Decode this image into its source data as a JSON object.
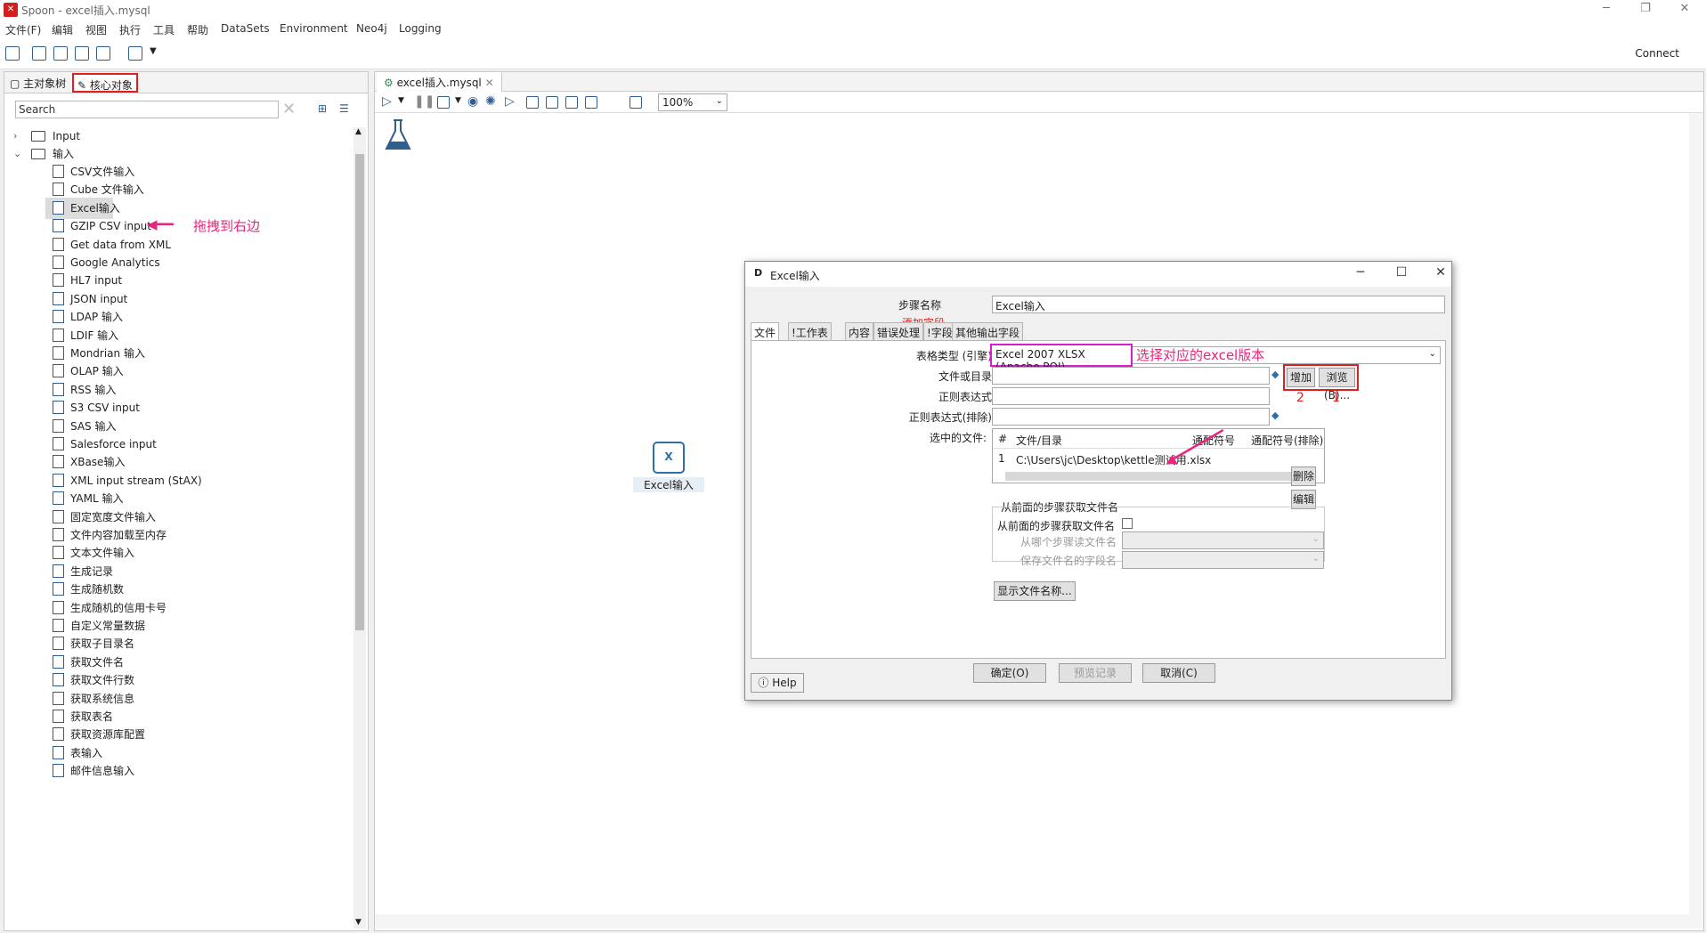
{
  "window": {
    "title": "Spoon - excel插入.mysql",
    "minimize_symbol": "─",
    "restore_symbol": "❐",
    "close_symbol": "✕"
  },
  "menubar": [
    "文件(F)",
    "编辑",
    "视图",
    "执行",
    "工具",
    "帮助",
    "DataSets",
    "Environment",
    "Neo4j",
    "Logging"
  ],
  "toolbar": {
    "connect_label": "Connect"
  },
  "left_panel": {
    "tabs": {
      "main_tree": "主对象树",
      "core_objects": "核心对象"
    },
    "search_placeholder": "Search",
    "tree": {
      "folders": [
        {
          "label": "Input",
          "expanded": false
        },
        {
          "label": "输入",
          "expanded": true
        }
      ],
      "steps": [
        "CSV文件输入",
        "Cube 文件输入",
        "Excel输入",
        "GZIP CSV input",
        "Get data from XML",
        "Google Analytics",
        "HL7 input",
        "JSON input",
        "LDAP 输入",
        "LDIF 输入",
        "Mondrian 输入",
        "OLAP 输入",
        "RSS 输入",
        "S3 CSV input",
        "SAS 输入",
        "Salesforce input",
        "XBase输入",
        "XML input stream (StAX)",
        "YAML 输入",
        "固定宽度文件输入",
        "文件内容加载至内存",
        "文本文件输入",
        "生成记录",
        "生成随机数",
        "生成随机的信用卡号",
        "自定义常量数据",
        "获取子目录名",
        "获取文件名",
        "获取文件行数",
        "获取系统信息",
        "获取表名",
        "获取资源库配置",
        "表输入",
        "邮件信息输入"
      ],
      "selected_index": 2
    }
  },
  "annotations": {
    "drag_hint": "拖拽到右边",
    "version_hint": "选择对应的excel版本",
    "num_1": "1",
    "num_2": "2"
  },
  "editor": {
    "tab_label": "excel插入.mysql",
    "zoom": "100%",
    "step_node_label": "Excel输入"
  },
  "dialog": {
    "title": "Excel输入",
    "step_name_label": "步骤名称",
    "step_name_value": "Excel输入",
    "add_fields_link": "添加字段",
    "tabs": [
      "文件",
      "!工作表",
      "内容",
      "错误处理",
      "!字段",
      "其他输出字段"
    ],
    "table_type_label": "表格类型 (引擎)",
    "table_type_value": "Excel 2007 XLSX (Apache POI)",
    "file_dir_label": "文件或目录",
    "regex_label": "正则表达式",
    "regex_exclude_label": "正则表达式(排除)",
    "selected_files_label": "选中的文件:",
    "add_button": "增加",
    "browse_button": "浏览(B)...",
    "grid": {
      "headers": [
        "#",
        "文件/目录",
        "通配符号",
        "通配符号(排除)"
      ],
      "rows": [
        {
          "num": "1",
          "path": "C:\\Users\\jc\\Desktop\\kettle测试用.xlsx",
          "wildcard": "",
          "wildcard_exclude": ""
        }
      ]
    },
    "delete_button": "删除",
    "edit_button": "编辑",
    "from_prev_group": "从前面的步骤获取文件名",
    "from_prev_checkbox_label": "从前面的步骤获取文件名",
    "from_step_label": "从哪个步骤读文件名",
    "save_field_label": "保存文件名的字段名",
    "show_filenames_button": "显示文件名称...",
    "help_button": "Help",
    "ok_button": "确定(O)",
    "preview_button": "预览记录",
    "cancel_button": "取消(C)"
  }
}
